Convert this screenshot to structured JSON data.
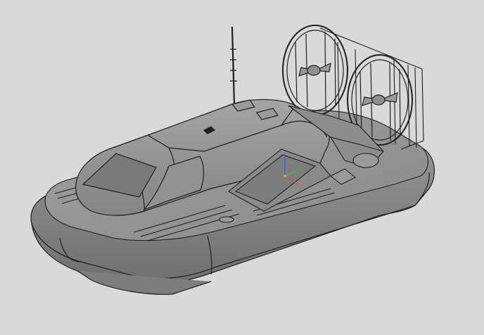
{
  "scene": {
    "subject": "hovercraft-3d-model",
    "background_color": "#d9d9d9",
    "body_color": "#8e8e8e",
    "edge_color": "#1f1f1f",
    "window_color": "#7a7a7a",
    "axis_colors": {
      "x": "#e05050",
      "y": "#40c040",
      "z": "#4060e0"
    }
  }
}
